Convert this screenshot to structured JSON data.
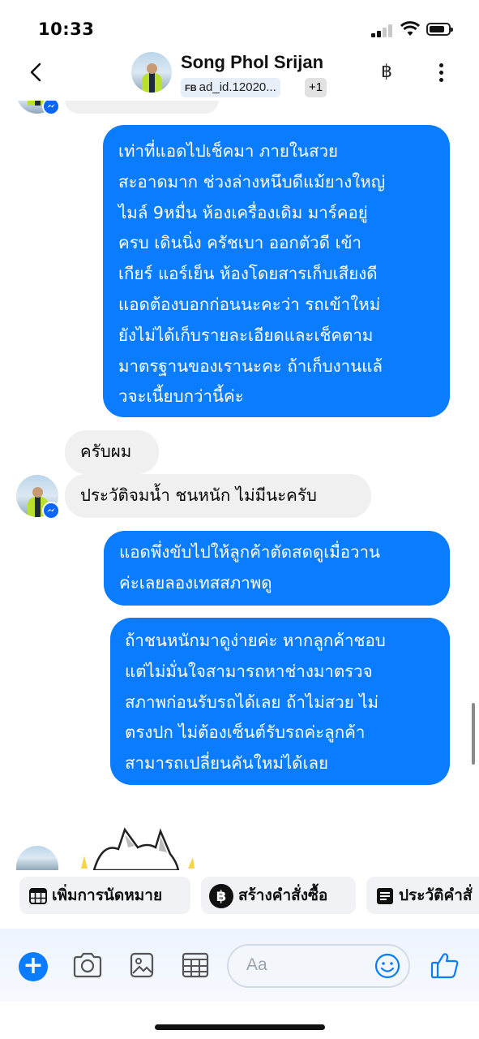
{
  "status_bar": {
    "time": "10:33"
  },
  "header": {
    "contact_name": "Song Phol Srijan",
    "ad_tag_prefix": "FB",
    "ad_tag": "ad_id.12020...",
    "extra_tags": "+1",
    "currency_symbol": "฿"
  },
  "messages": [
    {
      "side": "outgoing",
      "lines": [
        "เท่าที่แอดไปเช็คมา ภายในสวย",
        "สะอาดมาก ช่วงล่างหนึบดีแม้ยางใหญ่",
        "ไมล์ 9หมื่น ห้องเครื่องเดิม มาร์คอยู่",
        "ครบ เดินนิ่ง ครัชเบา ออกตัวดี เข้า",
        "เกียร์ แอร์เย็น ห้องโดยสารเก็บเสียงดี",
        "แอดต้องบอกก่อนนะคะว่า รถเข้าใหม่",
        "ยังไม่ได้เก็บรายละเอียดและเช็คตาม",
        "มาตรฐานของเรานะคะ ถ้าเก็บงานแล้",
        "วจะเนี้ยบกว่านี้ค่ะ"
      ]
    },
    {
      "side": "incoming",
      "lines": [
        "ครับผม"
      ]
    },
    {
      "side": "incoming",
      "lines": [
        "ประวัติจมน้ำ ชนหนัก ไม่มีนะครับ"
      ]
    },
    {
      "side": "outgoing",
      "lines": [
        "แอดพึ่งขับไปให้ลูกค้าตัดสดดูเมื่อวาน",
        "ค่ะเลยลองเทสสภาพดู"
      ]
    },
    {
      "side": "outgoing",
      "lines": [
        "ถ้าชนหนักมาดูง่ายค่ะ หากลูกค้าชอบ",
        "แต่ไม่มั่นใจสามารถหาช่างมาตรวจ",
        "สภาพก่อนรับรถได้เลย ถ้าไม่สวย ไม่",
        "ตรงปก ไม่ต้องเซ็นต์รับรถค่ะลูกค้า",
        "สามารถเปลี่ยนคันใหม่ได้เลย"
      ]
    }
  ],
  "quick_actions": [
    {
      "label": "เพิ่มการนัดหมาย",
      "icon": "calendar-icon"
    },
    {
      "label": "สร้างคำสั่งซื้อ",
      "icon": "baht-icon"
    },
    {
      "label": "ประวัติคำสั่",
      "icon": "list-icon"
    }
  ],
  "composer": {
    "placeholder": "Aa",
    "tools": [
      "plus-icon",
      "camera-icon",
      "gallery-icon",
      "template-icon",
      "emoji-icon",
      "thumbs-up-icon"
    ]
  }
}
